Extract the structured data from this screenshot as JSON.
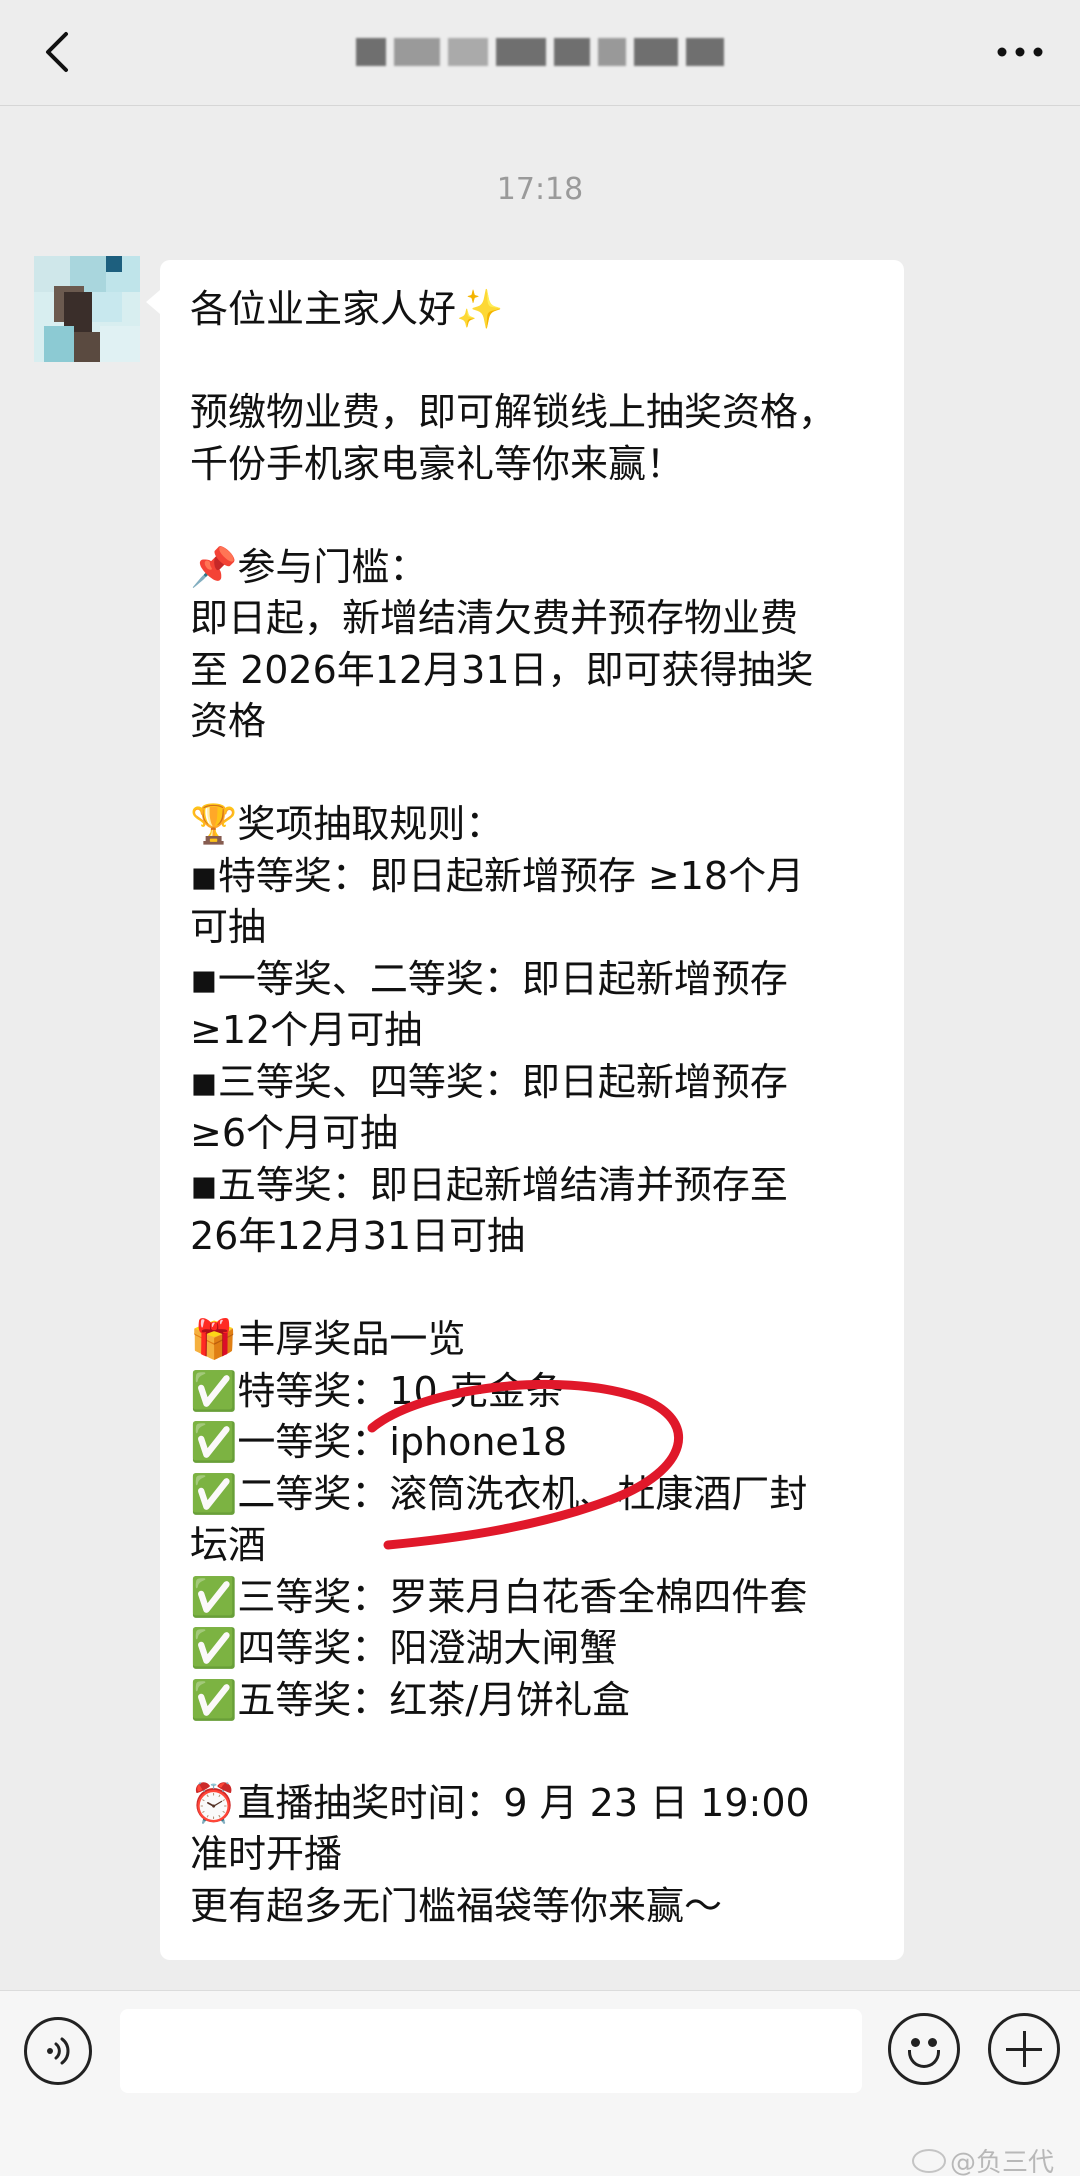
{
  "header": {
    "back_icon": "chevron-left-icon",
    "title": "",
    "more_icon": "more-dots-icon"
  },
  "timestamp": "17:18",
  "message": {
    "lines": [
      "各位业主家人好✨",
      "",
      "预缴物业费，即可解锁线上抽奖资格，",
      "千份手机家电豪礼等你来赢！",
      "",
      "📌参与门槛：",
      "即日起，新增结清欠费并预存物业费",
      "至 2026年12月31日，即可获得抽奖",
      "资格",
      "",
      "🏆奖项抽取规则：",
      "◾特等奖：即日起新增预存 ≥18个月",
      "可抽",
      "◾一等奖、二等奖：即日起新增预存",
      "≥12个月可抽",
      "◾三等奖、四等奖：即日起新增预存",
      "≥6个月可抽",
      "◾五等奖：即日起新增结清并预存至",
      "26年12月31日可抽",
      "",
      "🎁丰厚奖品一览",
      "✅特等奖：10 克金条",
      "✅一等奖：iphone18",
      "✅二等奖：滚筒洗衣机、杜康酒厂封",
      "坛酒",
      "✅三等奖：罗莱月白花香全棉四件套",
      "✅四等奖：阳澄湖大闸蟹",
      "✅五等奖：红茶/月饼礼盒",
      "",
      "⏰直播抽奖时间：9 月 23 日 19:00",
      "准时开播",
      "更有超多无门槛福袋等你来赢～"
    ]
  },
  "input": {
    "value": "",
    "voice_icon": "voice-icon",
    "emoji_icon": "emoji-icon",
    "plus_icon": "plus-icon"
  },
  "watermark": "@负三代",
  "colors": {
    "background": "#ededed",
    "bubble": "#ffffff",
    "annotation": "#e0182a"
  }
}
